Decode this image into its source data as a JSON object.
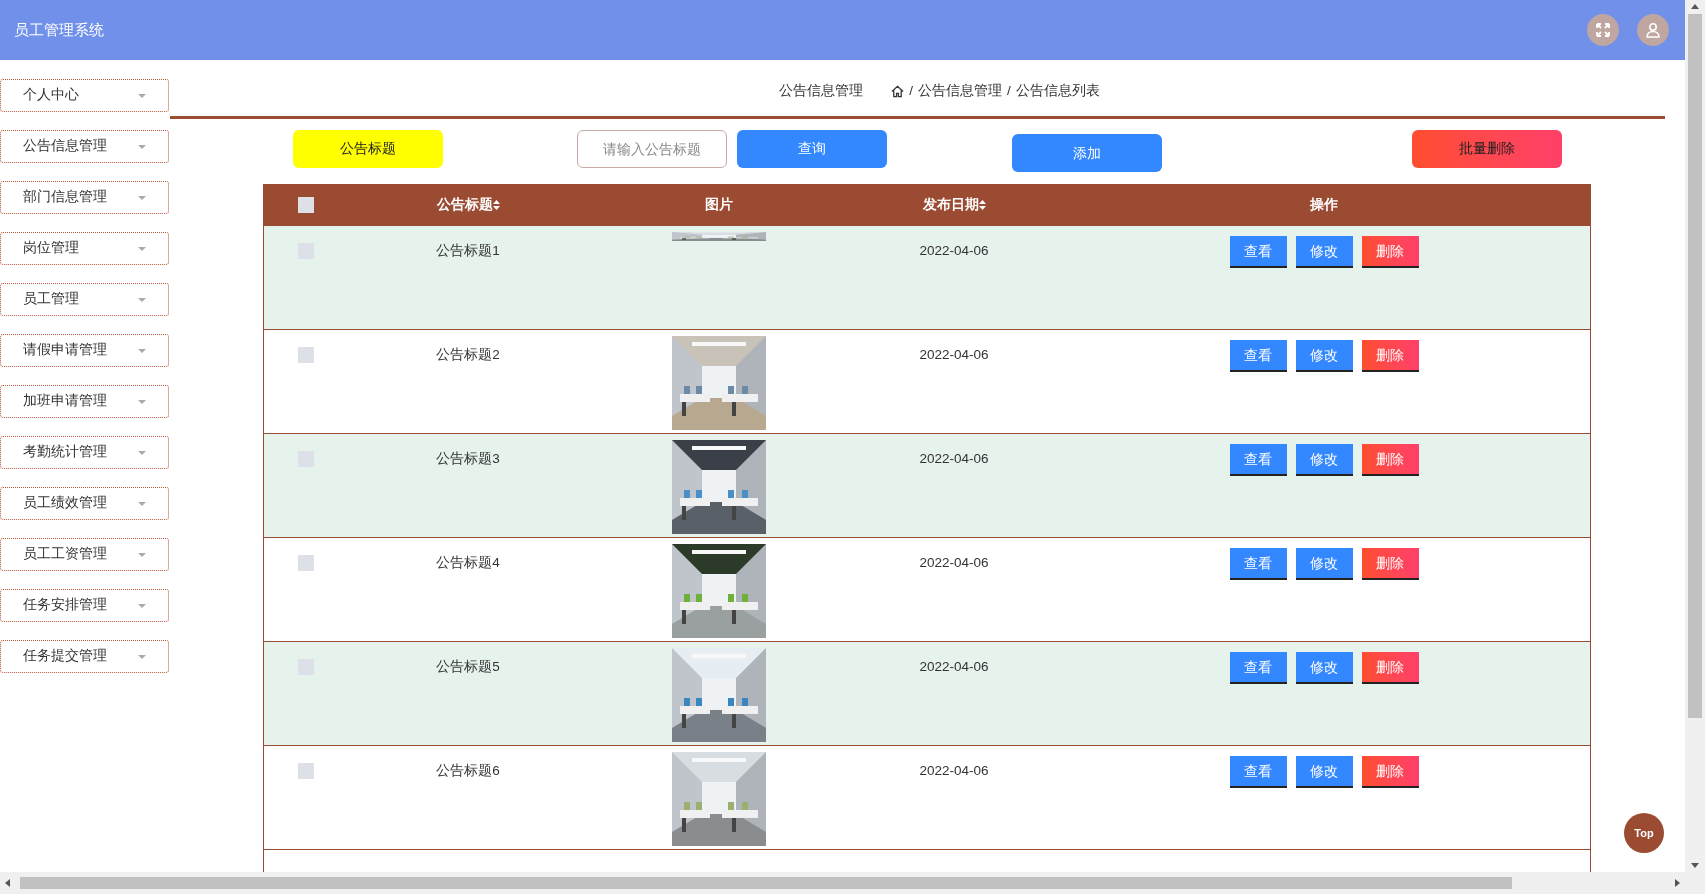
{
  "header": {
    "title": "员工管理系统"
  },
  "sidebar": {
    "items": [
      {
        "label": "个人中心"
      },
      {
        "label": "公告信息管理"
      },
      {
        "label": "部门信息管理"
      },
      {
        "label": "岗位管理"
      },
      {
        "label": "员工管理"
      },
      {
        "label": "请假申请管理"
      },
      {
        "label": "加班申请管理"
      },
      {
        "label": "考勤统计管理"
      },
      {
        "label": "员工绩效管理"
      },
      {
        "label": "员工工资管理"
      },
      {
        "label": "任务安排管理"
      },
      {
        "label": "任务提交管理"
      }
    ]
  },
  "page_title": "公告信息管理",
  "breadcrumb": [
    "公告信息管理",
    "公告信息列表"
  ],
  "breadcrumb_separator": "/",
  "toolbar": {
    "search_label": "公告标题",
    "search_placeholder": "请输入公告标题",
    "query_button": "查询",
    "add_button": "添加",
    "batch_delete_button": "批量删除"
  },
  "table": {
    "columns": [
      "公告标题",
      "图片",
      "发布日期",
      "操作"
    ],
    "header_checked": false,
    "rows": [
      {
        "checked": false,
        "title": "公告标题1",
        "picture_loaded": false,
        "date": "2022-04-06",
        "actions": [
          "查看",
          "修改",
          "删除"
        ]
      },
      {
        "checked": false,
        "title": "公告标题2",
        "picture_loaded": true,
        "date": "2022-04-06",
        "actions": [
          "查看",
          "修改",
          "删除"
        ]
      },
      {
        "checked": false,
        "title": "公告标题3",
        "picture_loaded": true,
        "date": "2022-04-06",
        "actions": [
          "查看",
          "修改",
          "删除"
        ]
      },
      {
        "checked": false,
        "title": "公告标题4",
        "picture_loaded": true,
        "date": "2022-04-06",
        "actions": [
          "查看",
          "修改",
          "删除"
        ]
      },
      {
        "checked": false,
        "title": "公告标题5",
        "picture_loaded": true,
        "date": "2022-04-06",
        "actions": [
          "查看",
          "修改",
          "删除"
        ]
      },
      {
        "checked": false,
        "title": "公告标题6",
        "picture_loaded": true,
        "date": "2022-04-06",
        "actions": [
          "查看",
          "修改",
          "删除"
        ]
      }
    ]
  },
  "back_to_top": "Top"
}
